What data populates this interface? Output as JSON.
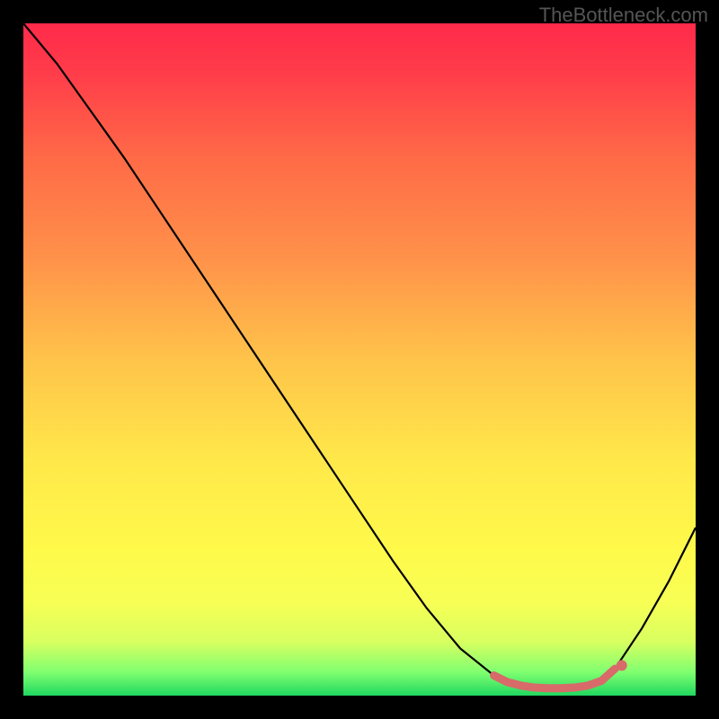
{
  "watermark": "TheBottleneck.com",
  "chart_data": {
    "type": "line",
    "title": "",
    "xlabel": "",
    "ylabel": "",
    "xlim": [
      0,
      100
    ],
    "ylim": [
      0,
      100
    ],
    "series": [
      {
        "name": "bottleneck-curve",
        "x": [
          0,
          5,
          10,
          15,
          20,
          25,
          30,
          35,
          40,
          45,
          50,
          55,
          60,
          65,
          70,
          72,
          74,
          76,
          78,
          80,
          82,
          84,
          86,
          88,
          92,
          96,
          100
        ],
        "y": [
          100,
          94,
          87,
          80,
          72.5,
          65,
          57.5,
          50,
          42.5,
          35,
          27.5,
          20,
          13,
          7,
          3,
          2,
          1.5,
          1.2,
          1.1,
          1.1,
          1.2,
          1.5,
          2.2,
          4,
          10,
          17,
          25
        ]
      }
    ],
    "plateau_marker": {
      "name": "optimal-range",
      "color": "#d86a6a",
      "x": [
        70,
        72,
        74,
        76,
        78,
        80,
        82,
        84,
        86,
        88
      ],
      "y": [
        3,
        2,
        1.5,
        1.2,
        1.1,
        1.1,
        1.2,
        1.5,
        2.2,
        4
      ]
    },
    "gradient_stops": [
      {
        "offset": 0.0,
        "color": "#ff2a4a"
      },
      {
        "offset": 0.07,
        "color": "#ff3b4a"
      },
      {
        "offset": 0.2,
        "color": "#ff6a47"
      },
      {
        "offset": 0.35,
        "color": "#ff924a"
      },
      {
        "offset": 0.5,
        "color": "#ffc34a"
      },
      {
        "offset": 0.65,
        "color": "#ffe84a"
      },
      {
        "offset": 0.78,
        "color": "#fff94a"
      },
      {
        "offset": 0.86,
        "color": "#f8ff55"
      },
      {
        "offset": 0.92,
        "color": "#d8ff60"
      },
      {
        "offset": 0.965,
        "color": "#80ff70"
      },
      {
        "offset": 1.0,
        "color": "#20d860"
      }
    ]
  }
}
